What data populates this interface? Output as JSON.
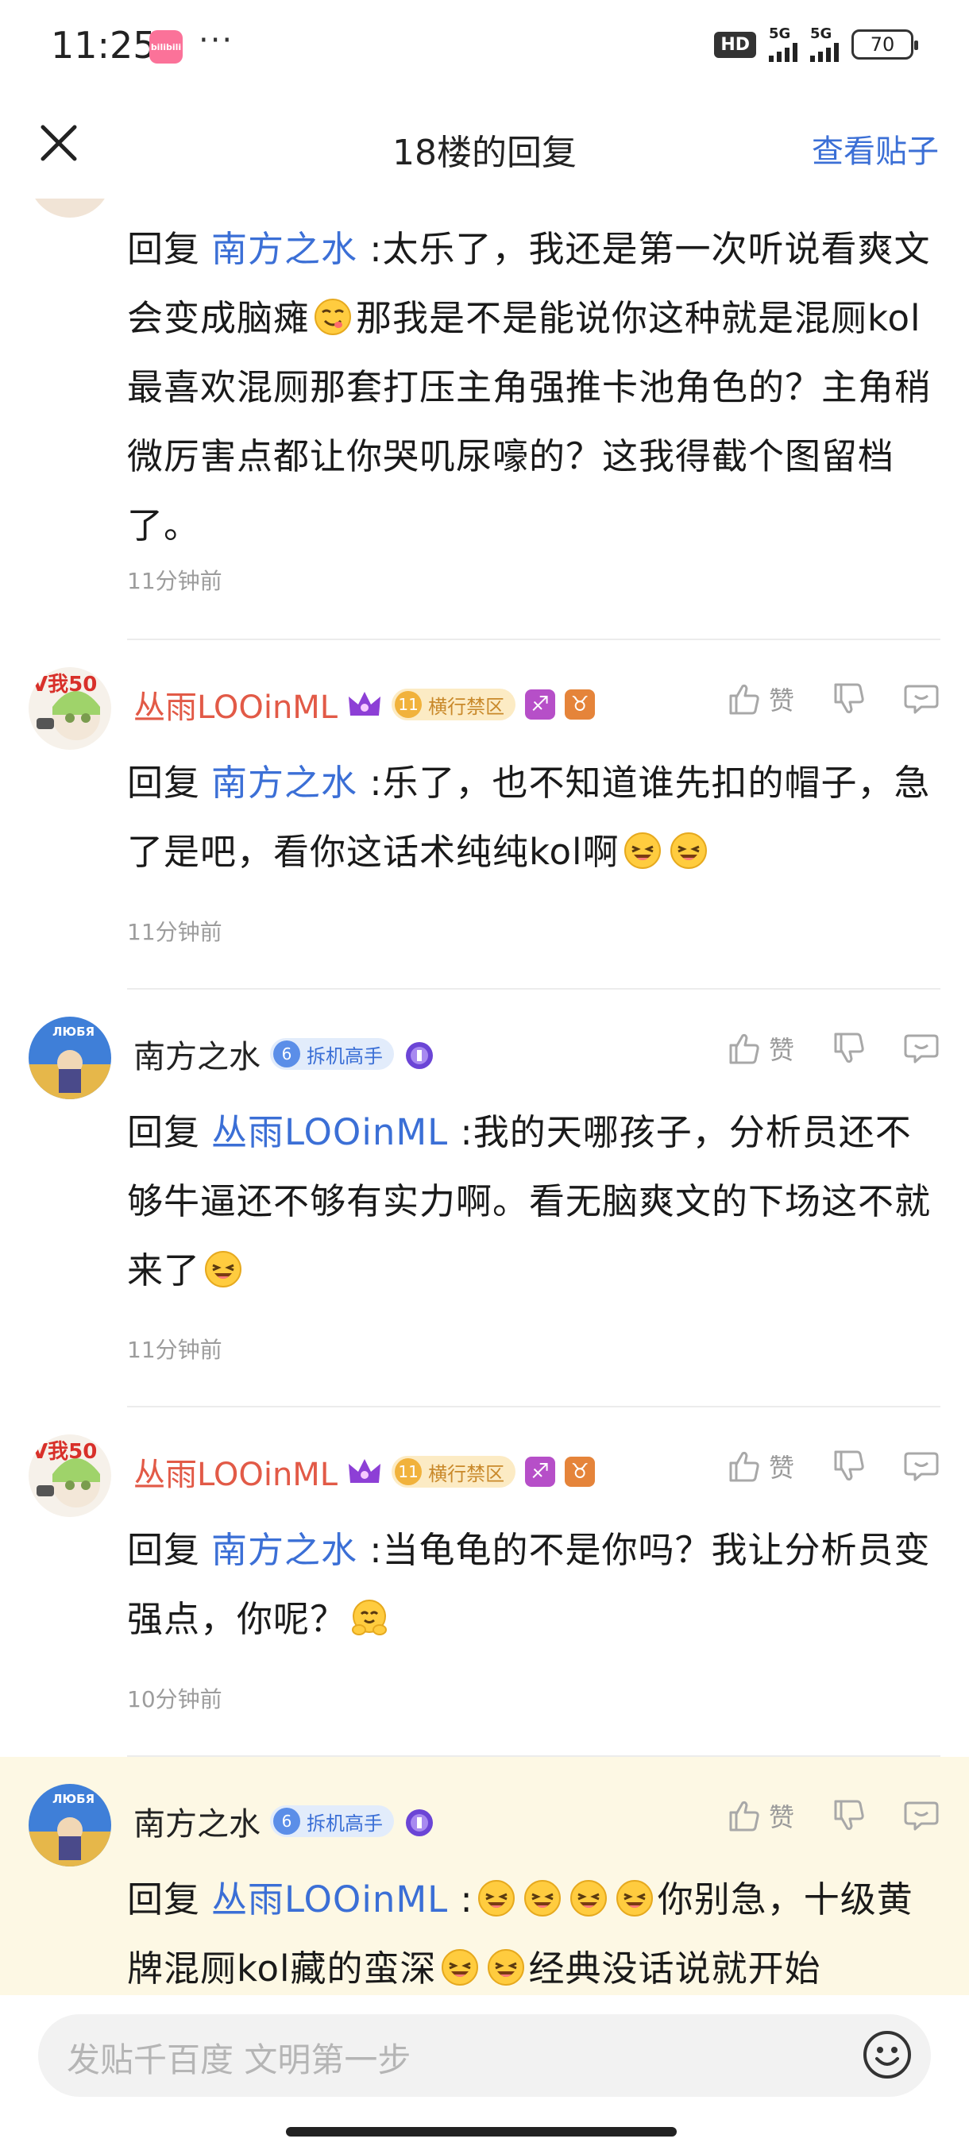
{
  "status": {
    "time": "11:25",
    "app_badge": "bilibili",
    "more": "···",
    "hd": "HD",
    "sim1": "5G",
    "sim2": "5G",
    "battery": "70"
  },
  "header": {
    "title": "18楼的回复",
    "view_post": "查看贴子"
  },
  "replies": [
    {
      "prefix": "回复",
      "mention": "南方之水",
      "text": " :太乐了，我还是第一次听说看爽文会变成脑瘫",
      "text2": "那我是不是能说你这种就是混厕kol最喜欢混厕那套打压主角强推卡池角色的？主角稍微厉害点都让你哭叽尿嚎的？这我得截个图留档了。",
      "time": "11分钟前"
    },
    {
      "author": "丛雨LOOinML",
      "level": "11",
      "badge": "横行禁区",
      "like": "赞",
      "prefix": "回复",
      "mention": "南方之水",
      "text": " :乐了，也不知道谁先扣的帽子，急了是吧，看你这话术纯纯kol啊",
      "time": "11分钟前"
    },
    {
      "author": "南方之水",
      "level": "6",
      "badge": "拆机高手",
      "like": "赞",
      "prefix": "回复",
      "mention": "丛雨LOOinML",
      "text": " :我的天哪孩子，分析员还不够牛逼还不够有实力啊。看无脑爽文的下场这不就来了",
      "time": "11分钟前"
    },
    {
      "author": "丛雨LOOinML",
      "level": "11",
      "badge": "横行禁区",
      "like": "赞",
      "prefix": "回复",
      "mention": "南方之水",
      "text": " :当龟龟的不是你吗？我让分析员变强点，你呢？",
      "time": "10分钟前"
    },
    {
      "author": "南方之水",
      "level": "6",
      "badge": "拆机高手",
      "like": "赞",
      "prefix": "回复",
      "mention": "丛雨LOOinML",
      "text": " :",
      "text2": "你别急，十级黄牌混厕kol藏的蛮深",
      "text3": "经典没话说就开始"
    }
  ],
  "avatar_text": {
    "v50": "V我50",
    "nf": "ЛЮБЯ"
  },
  "input": {
    "placeholder": "发贴千百度 文明第一步"
  },
  "colors": {
    "accent": "#3b6fd6",
    "red_name": "#e25a47",
    "highlight_bg": "#fdf8e4"
  },
  "icons": [
    "close-icon",
    "like-icon",
    "dislike-icon",
    "comment-icon",
    "emoji-icon",
    "crown-icon",
    "sagittarius-icon",
    "taurus-icon",
    "medal-icon"
  ]
}
